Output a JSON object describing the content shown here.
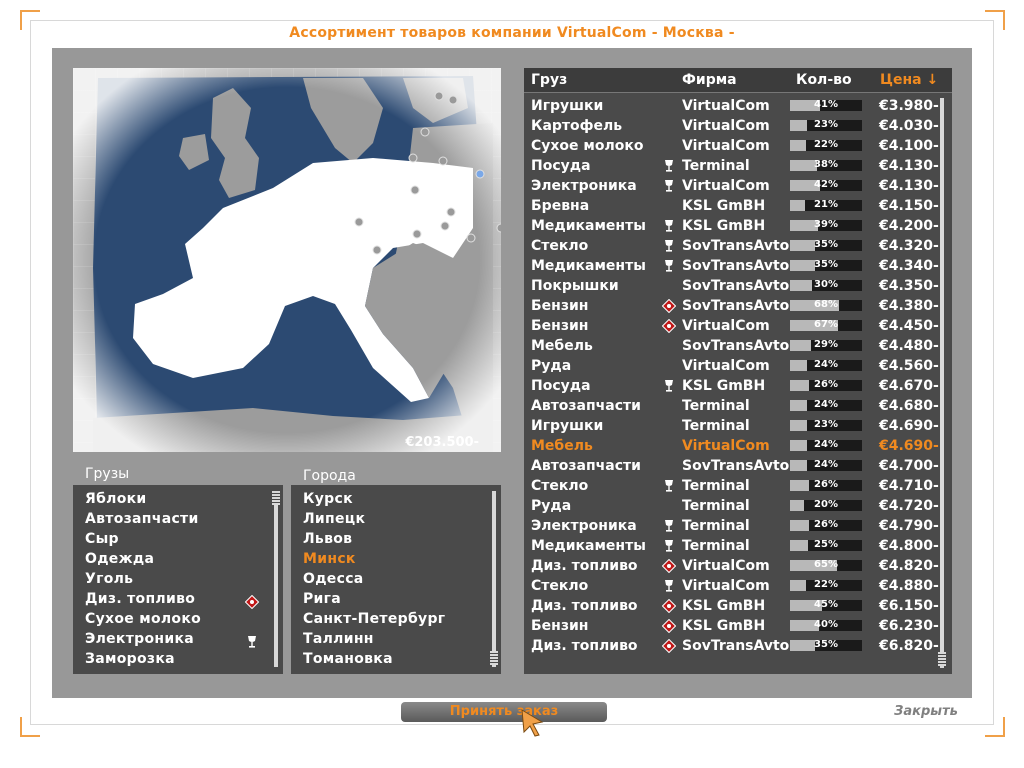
{
  "title": "Ассортимент товаров компании VirtualCom - Москва -",
  "map": {
    "money": "€203.500-"
  },
  "cargo_list": {
    "header": "Грузы",
    "selected": "",
    "items": [
      {
        "label": "Яблоки",
        "icon": ""
      },
      {
        "label": "Автозапчасти",
        "icon": ""
      },
      {
        "label": "Сыр",
        "icon": ""
      },
      {
        "label": "Одежда",
        "icon": ""
      },
      {
        "label": "Уголь",
        "icon": ""
      },
      {
        "label": "Диз. топливо",
        "icon": "hazard-icon"
      },
      {
        "label": "Сухое молоко",
        "icon": ""
      },
      {
        "label": "Электроника",
        "icon": "fragile-icon"
      },
      {
        "label": "Заморозка",
        "icon": ""
      }
    ]
  },
  "city_list": {
    "header": "Города",
    "selected": "Минск",
    "items": [
      "Курск",
      "Липецк",
      "Львов",
      "Минск",
      "Одесса",
      "Рига",
      "Санкт-Петербург",
      "Таллинн",
      "Томановка"
    ]
  },
  "table": {
    "columns": {
      "cargo": "Груз",
      "company": "Фирма",
      "qty": "Кол-во",
      "price": "Цена ↓"
    },
    "sort_column": "price",
    "selected_row": 17,
    "rows": [
      {
        "cargo": "Игрушки",
        "icon": "",
        "company": "VirtualCom",
        "qty": 41,
        "qty_label": "41%",
        "price": "€3.980-"
      },
      {
        "cargo": "Картофель",
        "icon": "",
        "company": "VirtualCom",
        "qty": 23,
        "qty_label": "23%",
        "price": "€4.030-"
      },
      {
        "cargo": "Сухое молоко",
        "icon": "",
        "company": "VirtualCom",
        "qty": 22,
        "qty_label": "22%",
        "price": "€4.100-"
      },
      {
        "cargo": "Посуда",
        "icon": "fragile-icon",
        "company": "Terminal",
        "qty": 38,
        "qty_label": "38%",
        "price": "€4.130-"
      },
      {
        "cargo": "Электроника",
        "icon": "fragile-icon",
        "company": "VirtualCom",
        "qty": 42,
        "qty_label": "42%",
        "price": "€4.130-"
      },
      {
        "cargo": "Бревна",
        "icon": "",
        "company": "KSL GmBH",
        "qty": 21,
        "qty_label": "21%",
        "price": "€4.150-"
      },
      {
        "cargo": "Медикаменты",
        "icon": "fragile-icon",
        "company": "KSL GmBH",
        "qty": 39,
        "qty_label": "39%",
        "price": "€4.200-"
      },
      {
        "cargo": "Стекло",
        "icon": "fragile-icon",
        "company": "SovTransAvto",
        "qty": 35,
        "qty_label": "35%",
        "price": "€4.320-"
      },
      {
        "cargo": "Медикаменты",
        "icon": "fragile-icon",
        "company": "SovTransAvto",
        "qty": 35,
        "qty_label": "35%",
        "price": "€4.340-"
      },
      {
        "cargo": "Покрышки",
        "icon": "",
        "company": "SovTransAvto",
        "qty": 30,
        "qty_label": "30%",
        "price": "€4.350-"
      },
      {
        "cargo": "Бензин",
        "icon": "hazard-icon",
        "company": "SovTransAvto",
        "qty": 68,
        "qty_label": "68%",
        "price": "€4.380-"
      },
      {
        "cargo": "Бензин",
        "icon": "hazard-icon",
        "company": "VirtualCom",
        "qty": 67,
        "qty_label": "67%",
        "price": "€4.450-"
      },
      {
        "cargo": "Мебель",
        "icon": "",
        "company": "SovTransAvto",
        "qty": 29,
        "qty_label": "29%",
        "price": "€4.480-"
      },
      {
        "cargo": "Руда",
        "icon": "",
        "company": "VirtualCom",
        "qty": 24,
        "qty_label": "24%",
        "price": "€4.560-"
      },
      {
        "cargo": "Посуда",
        "icon": "fragile-icon",
        "company": "KSL GmBH",
        "qty": 26,
        "qty_label": "26%",
        "price": "€4.670-"
      },
      {
        "cargo": "Автозапчасти",
        "icon": "",
        "company": "Terminal",
        "qty": 24,
        "qty_label": "24%",
        "price": "€4.680-"
      },
      {
        "cargo": "Игрушки",
        "icon": "",
        "company": "Terminal",
        "qty": 23,
        "qty_label": "23%",
        "price": "€4.690-"
      },
      {
        "cargo": "Мебель",
        "icon": "",
        "company": "VirtualCom",
        "qty": 24,
        "qty_label": "24%",
        "price": "€4.690-"
      },
      {
        "cargo": "Автозапчасти",
        "icon": "",
        "company": "SovTransAvto",
        "qty": 24,
        "qty_label": "24%",
        "price": "€4.700-"
      },
      {
        "cargo": "Стекло",
        "icon": "fragile-icon",
        "company": "Terminal",
        "qty": 26,
        "qty_label": "26%",
        "price": "€4.710-"
      },
      {
        "cargo": "Руда",
        "icon": "",
        "company": "Terminal",
        "qty": 20,
        "qty_label": "20%",
        "price": "€4.720-"
      },
      {
        "cargo": "Электроника",
        "icon": "fragile-icon",
        "company": "Terminal",
        "qty": 26,
        "qty_label": "26%",
        "price": "€4.790-"
      },
      {
        "cargo": "Медикаменты",
        "icon": "fragile-icon",
        "company": "Terminal",
        "qty": 25,
        "qty_label": "25%",
        "price": "€4.800-"
      },
      {
        "cargo": "Диз. топливо",
        "icon": "hazard-icon",
        "company": "VirtualCom",
        "qty": 65,
        "qty_label": "65%",
        "price": "€4.820-"
      },
      {
        "cargo": "Стекло",
        "icon": "fragile-icon",
        "company": "VirtualCom",
        "qty": 22,
        "qty_label": "22%",
        "price": "€4.880-"
      },
      {
        "cargo": "Диз. топливо",
        "icon": "hazard-icon",
        "company": "KSL GmBH",
        "qty": 45,
        "qty_label": "45%",
        "price": "€6.150-"
      },
      {
        "cargo": "Бензин",
        "icon": "hazard-icon",
        "company": "KSL GmBH",
        "qty": 40,
        "qty_label": "40%",
        "price": "€6.230-"
      },
      {
        "cargo": "Диз. топливо",
        "icon": "hazard-icon",
        "company": "SovTransAvto",
        "qty": 35,
        "qty_label": "35%",
        "price": "€6.820-"
      }
    ]
  },
  "buttons": {
    "accept": "Принять заказ",
    "close": "Закрыть"
  },
  "colors": {
    "accent": "#f08a20",
    "panel": "#4a4a4a",
    "sea": "#2c4a72",
    "land": "#ffffff"
  }
}
